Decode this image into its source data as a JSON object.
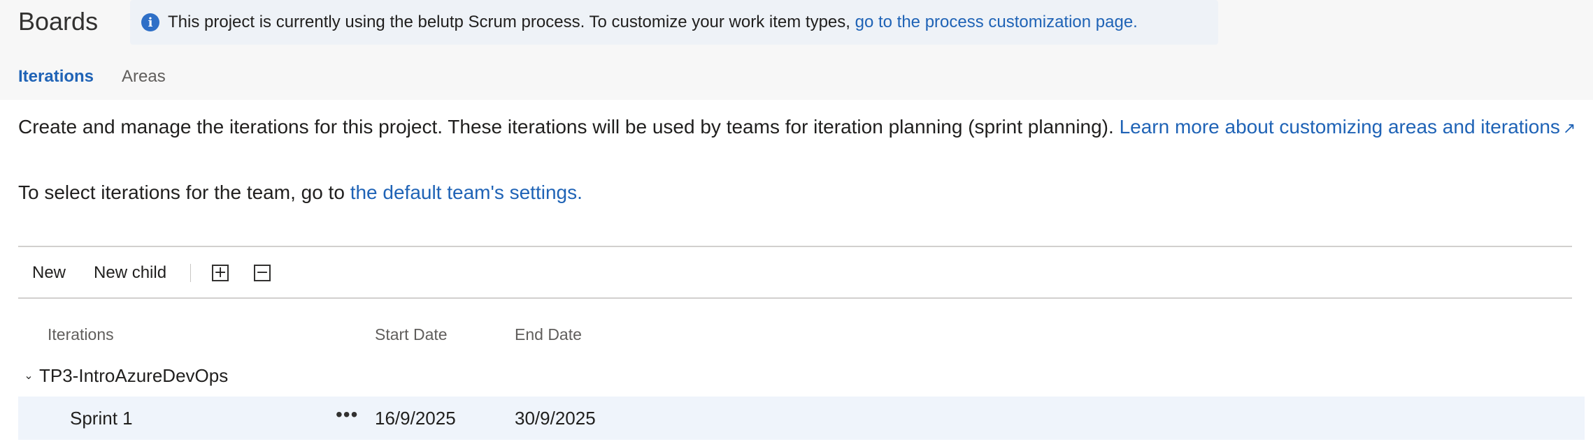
{
  "header": {
    "title": "Boards",
    "banner": {
      "text": "This project is currently using the belutp Scrum process. To customize your work item types, ",
      "link": "go to the process customization page."
    },
    "tabs": [
      {
        "label": "Iterations",
        "active": true
      },
      {
        "label": "Areas",
        "active": false
      }
    ]
  },
  "description": {
    "text": "Create and manage the iterations for this project. These iterations will be used by teams for iteration planning (sprint planning). ",
    "link": "Learn more about customizing areas and iterations",
    "select_text": "To select iterations for the team, go to ",
    "select_link": "the default team's settings."
  },
  "toolbar": {
    "new_label": "New",
    "new_child_label": "New child",
    "expand_icon": "expand-all-icon",
    "collapse_icon": "collapse-all-icon"
  },
  "table": {
    "headers": [
      "Iterations",
      "Start Date",
      "End Date"
    ],
    "root": "TP3-IntroAzureDevOps",
    "rows": [
      {
        "name": "Sprint 1",
        "start": "16/9/2025",
        "end": "30/9/2025"
      }
    ]
  },
  "colors": {
    "accent": "#1f63b6",
    "selected_row": "#eff4fb",
    "banner_bg": "#eef2f7",
    "top_bg": "#f7f7f7"
  }
}
